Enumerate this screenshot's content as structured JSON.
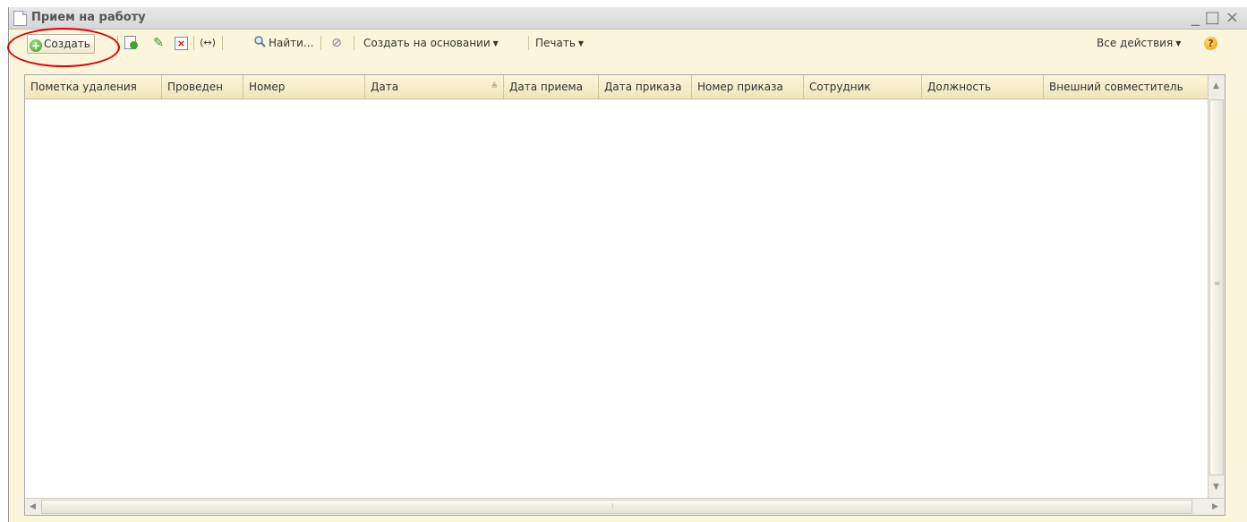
{
  "window": {
    "title": "Прием на работу",
    "controls": {
      "minimize": "_",
      "maximize": "□",
      "close": "×"
    }
  },
  "toolbar": {
    "create_label": "Создать",
    "create_icon": "plus-circle-icon",
    "find_label": "Найти...",
    "range_label": "(↔)",
    "based_on_label": "Создать на основании",
    "print_label": "Печать",
    "all_actions_label": "Все действия",
    "help_label": "?"
  },
  "grid": {
    "columns": [
      "Пометка удаления",
      "Проведен",
      "Номер",
      "Дата",
      "Дата приема",
      "Дата приказа",
      "Номер приказа",
      "Сотрудник",
      "Должность",
      "Внешний совместитель"
    ],
    "sorted_column": "Дата",
    "rows": []
  },
  "colors": {
    "window_bg": "#fbf5dc",
    "header_bg": "#efe5bd",
    "highlight": "#e00000",
    "create_icon": "#3d9a2a"
  }
}
